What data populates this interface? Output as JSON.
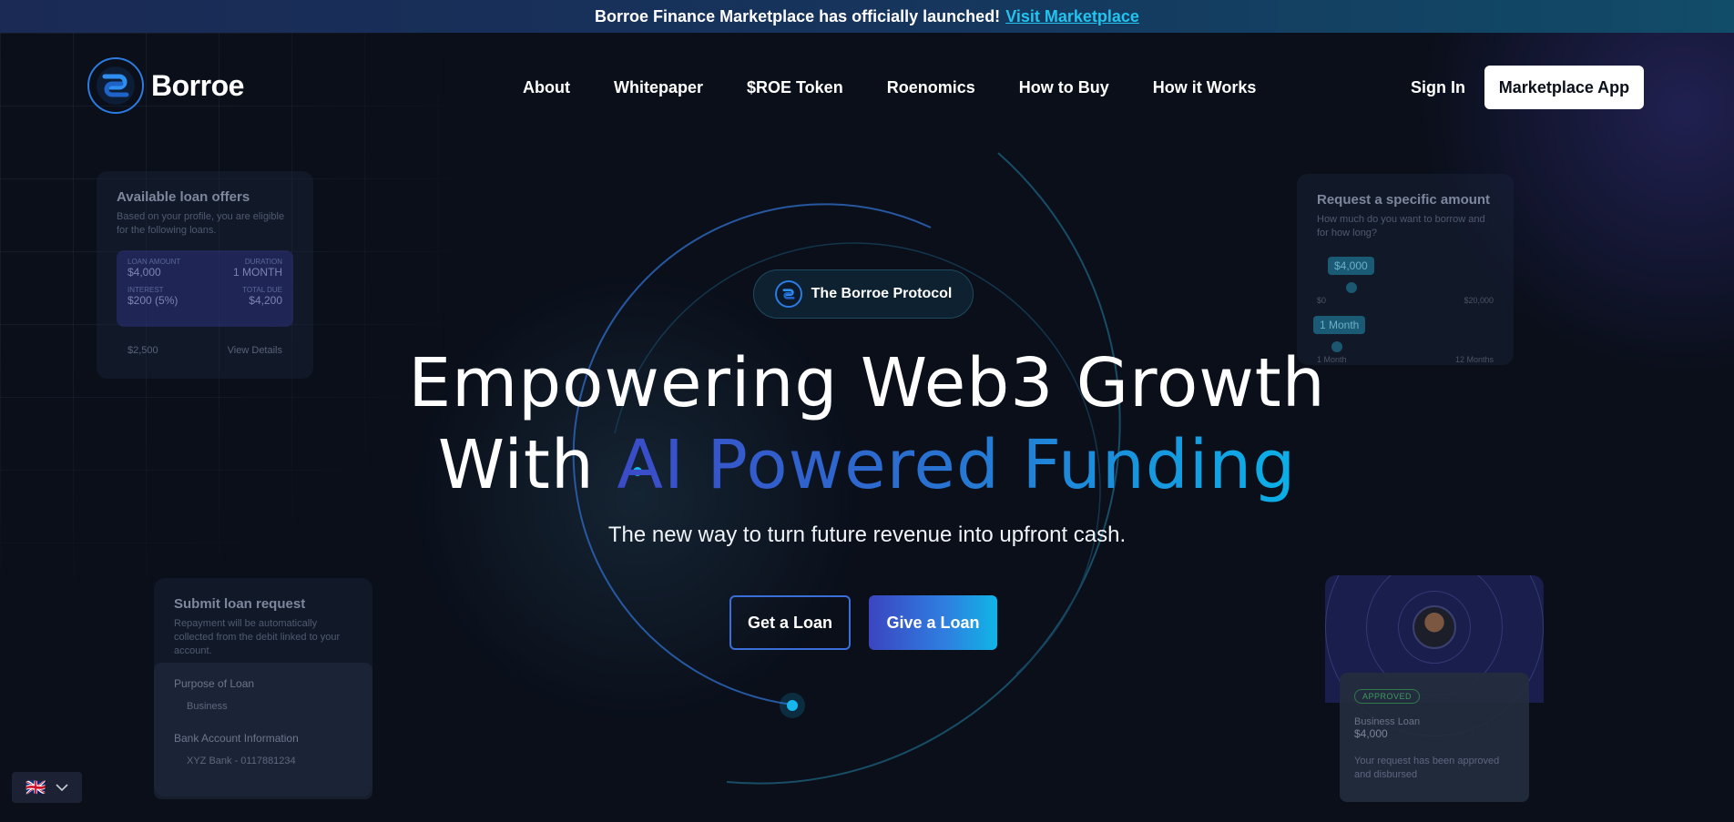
{
  "announcement": {
    "text": "Borroe Finance Marketplace has officially launched!",
    "link_label": "Visit Marketplace"
  },
  "header": {
    "brand": "Borroe",
    "nav": [
      "About",
      "Whitepaper",
      "$ROE Token",
      "Roenomics",
      "How to Buy",
      "How it Works"
    ],
    "signin_label": "Sign In",
    "app_button_label": "Marketplace App"
  },
  "hero": {
    "badge_label": "The Borroe Protocol",
    "title_line1": "Empowering Web3 Growth",
    "title_line2_prefix": "With ",
    "title_line2_highlight": "AI Powered Funding",
    "subtitle": "The new way to turn future revenue into upfront cash.",
    "primary_cta": "Get a Loan",
    "secondary_cta": "Give a Loan"
  },
  "cards": {
    "offers": {
      "title": "Available loan offers",
      "desc": "Based on your profile, you are eligible for the following loans.",
      "loan_amount_key": "LOAN AMOUNT",
      "loan_amount": "$4,000",
      "duration_key": "DURATION",
      "duration": "1 MONTH",
      "interest_key": "INTEREST",
      "interest": "$200 (5%)",
      "total_due_key": "TOTAL DUE",
      "total_due": "$4,200",
      "second_amount": "$2,500",
      "view_details": "View Details"
    },
    "request": {
      "title": "Request a specific amount",
      "desc": "How much do you want to borrow and for how long?",
      "amount_pill": "$4,000",
      "amount_min": "$0",
      "amount_max": "$20,000",
      "duration_pill": "1 Month",
      "duration_min": "1 Month",
      "duration_max": "12 Months"
    },
    "submit": {
      "title": "Submit loan request",
      "desc": "Repayment will be automatically collected from the debit linked to your account.",
      "purpose_label": "Purpose of Loan",
      "purpose_value": "Business",
      "bank_label": "Bank Account Information",
      "bank_value": "XYZ Bank - 0117881234"
    },
    "approved": {
      "status": "APPROVED",
      "loan_type": "Business Loan",
      "amount": "$4,000",
      "message": "Your request has been approved and disbursed"
    }
  },
  "language": {
    "flag": "🇬🇧"
  },
  "colors": {
    "background": "#0a0f1a",
    "accent_blue": "#2b7be0",
    "accent_cyan": "#0bb0e8",
    "link": "#22c3ee"
  }
}
